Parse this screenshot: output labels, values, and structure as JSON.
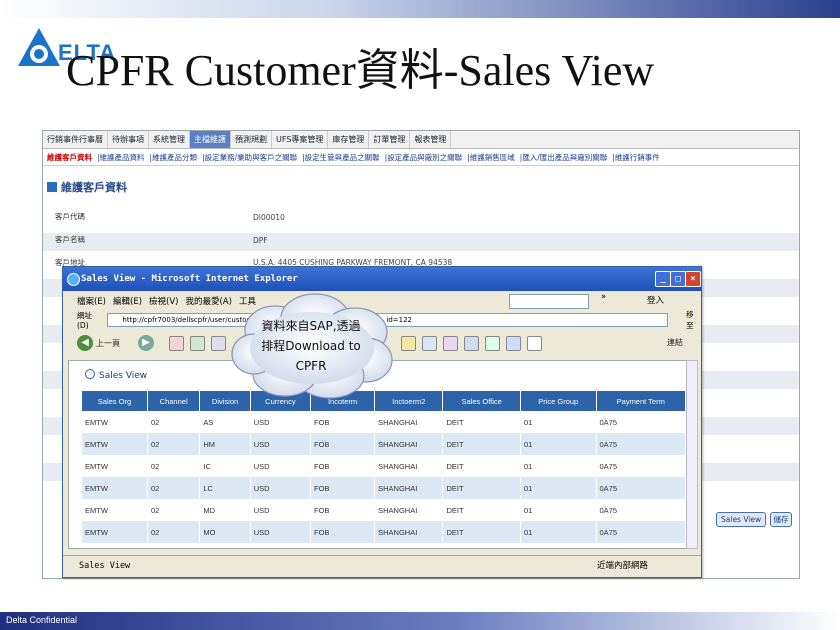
{
  "slide": {
    "title": "CPFR Customer資料-Sales View",
    "logo_text": "ELTA",
    "footer": "Delta Confidential"
  },
  "app": {
    "menu": [
      "行銷事件行事曆",
      "待辦事項",
      "系統管理",
      "主檔維護",
      "預測規劃",
      "UFS專案管理",
      "庫存管理",
      "訂單管理",
      "報表管理"
    ],
    "active_menu_index": 3,
    "submenu": [
      "維護客戶資料",
      "維護產品資料",
      "維護產品分類",
      "設定業務/業助與客戶之關聯",
      "設定生管與產品之關聯",
      "設定產品與廠別之關聯",
      "維護銷售區域",
      "匯入/匯出產品與廠別關聯",
      "維護行銷事件"
    ],
    "section_title": "維護客戶資料",
    "fields": [
      {
        "label": "客戶代碼",
        "value": "DI00010"
      },
      {
        "label": "客戶名稱",
        "value": "DPF"
      },
      {
        "label": "客戶地址",
        "value": "U.S.A. 4405 CUSHING PARKWAY FREMONT, CA 94538"
      }
    ],
    "buttons": {
      "sales_view": "Sales View",
      "query": "儲存"
    }
  },
  "ie": {
    "title": "Sales View - Microsoft Internet Explorer",
    "menu": [
      "檔案(E)",
      "編輯(E)",
      "檢視(V)",
      "我的最愛(A)",
      "工具"
    ],
    "search_chevron": "»",
    "login": "登入",
    "address_label": "網址(D)",
    "address": "http://cpfr7003/dellscpfr/user/customerMe",
    "address_tail": "id=122",
    "go": "移至",
    "back": "上一頁",
    "links": "連結",
    "status_left": "Sales View",
    "status_right": "近端內部網路"
  },
  "sales_view": {
    "heading": "Sales View",
    "columns": [
      "Sales Org",
      "Channel",
      "Division",
      "Currency",
      "Incoterm",
      "Inctoerm2",
      "Sales Office",
      "Price Group",
      "Payment Term"
    ],
    "rows": [
      [
        "EMTW",
        "02",
        "AS",
        "USD",
        "FOB",
        "SHANGHAI",
        "DEIT",
        "01",
        "0A75"
      ],
      [
        "EMTW",
        "02",
        "HM",
        "USD",
        "FOB",
        "SHANGHAI",
        "DEIT",
        "01",
        "0A75"
      ],
      [
        "EMTW",
        "02",
        "IC",
        "USD",
        "FOB",
        "SHANGHAI",
        "DEIT",
        "01",
        "0A75"
      ],
      [
        "EMTW",
        "02",
        "LC",
        "USD",
        "FOB",
        "SHANGHAI",
        "DEIT",
        "01",
        "0A75"
      ],
      [
        "EMTW",
        "02",
        "MD",
        "USD",
        "FOB",
        "SHANGHAI",
        "DEIT",
        "01",
        "0A75"
      ],
      [
        "EMTW",
        "02",
        "MO",
        "USD",
        "FOB",
        "SHANGHAI",
        "DEIT",
        "01",
        "0A75"
      ]
    ]
  },
  "callout": {
    "line1": "資料來自SAP,透過",
    "line2": "排程Download to",
    "line3": "CPFR"
  }
}
